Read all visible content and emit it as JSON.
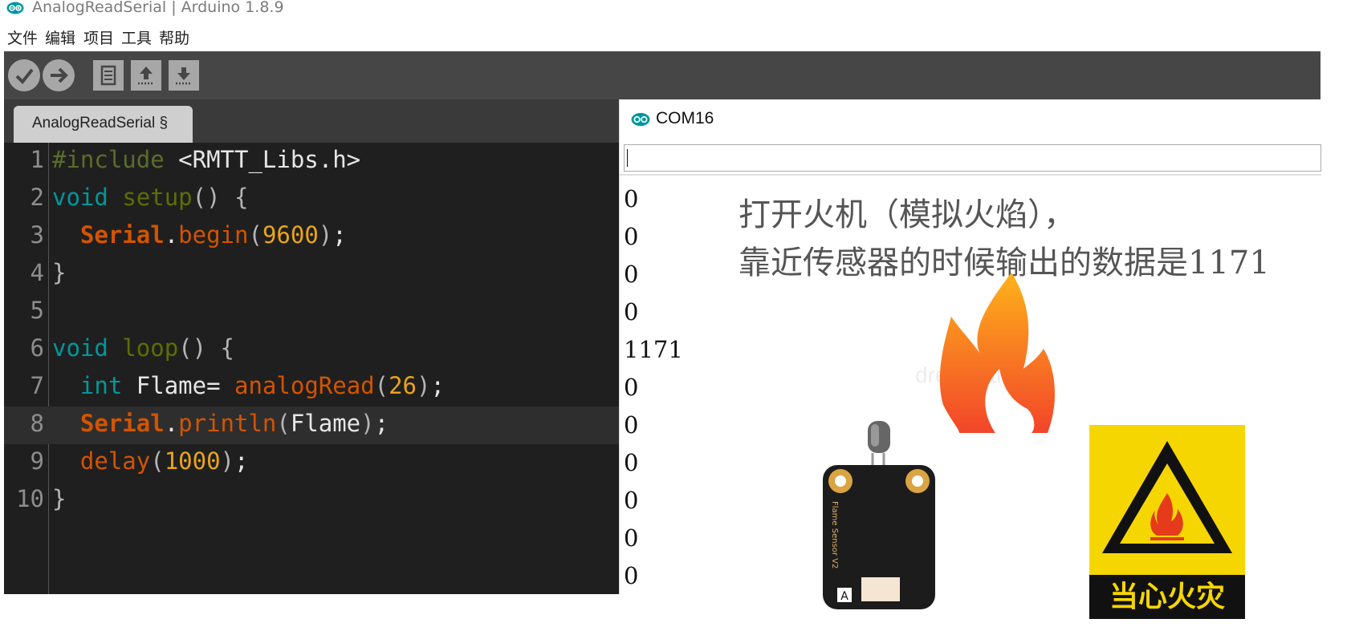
{
  "window": {
    "title": "AnalogReadSerial | Arduino 1.8.9"
  },
  "menu": [
    "文件",
    "编辑",
    "项目",
    "工具",
    "帮助"
  ],
  "toolbar": {
    "buttons": [
      "verify",
      "upload",
      "new",
      "open",
      "save"
    ]
  },
  "editor": {
    "tab_label": "AnalogReadSerial §",
    "lines": [
      {
        "n": "1",
        "text": "#include <RMTT_Libs.h>"
      },
      {
        "n": "2",
        "text": "void setup() {"
      },
      {
        "n": "3",
        "text": "  Serial.begin(9600);"
      },
      {
        "n": "4",
        "text": "}"
      },
      {
        "n": "5",
        "text": ""
      },
      {
        "n": "6",
        "text": "void loop() {"
      },
      {
        "n": "7",
        "text": "  int Flame= analogRead(26);"
      },
      {
        "n": "8",
        "text": "  Serial.println(Flame);"
      },
      {
        "n": "9",
        "text": "  delay(1000);"
      },
      {
        "n": "10",
        "text": "}"
      }
    ],
    "highlighted_line": 8
  },
  "serial_monitor": {
    "title": "COM16",
    "input_value": "",
    "output": [
      "0",
      "0",
      "0",
      "0",
      "1171",
      "0",
      "0",
      "0",
      "0",
      "0",
      "0"
    ]
  },
  "overlay": {
    "line1": "打开火机（模拟火焰），",
    "line2": "靠近传感器的时候输出的数据是1171"
  },
  "images": {
    "sensor_label": "Flame Sensor V2",
    "sensor_pin_label": "A",
    "warning_label": "当心火灾",
    "watermark": "dreamstime."
  },
  "colors": {
    "toolbar_bg": "#464646",
    "editor_bg": "#1f1f1f",
    "keyword": "#00979c",
    "object": "#d35400",
    "number": "#e9a41a",
    "warning_yellow": "#f6d600"
  }
}
